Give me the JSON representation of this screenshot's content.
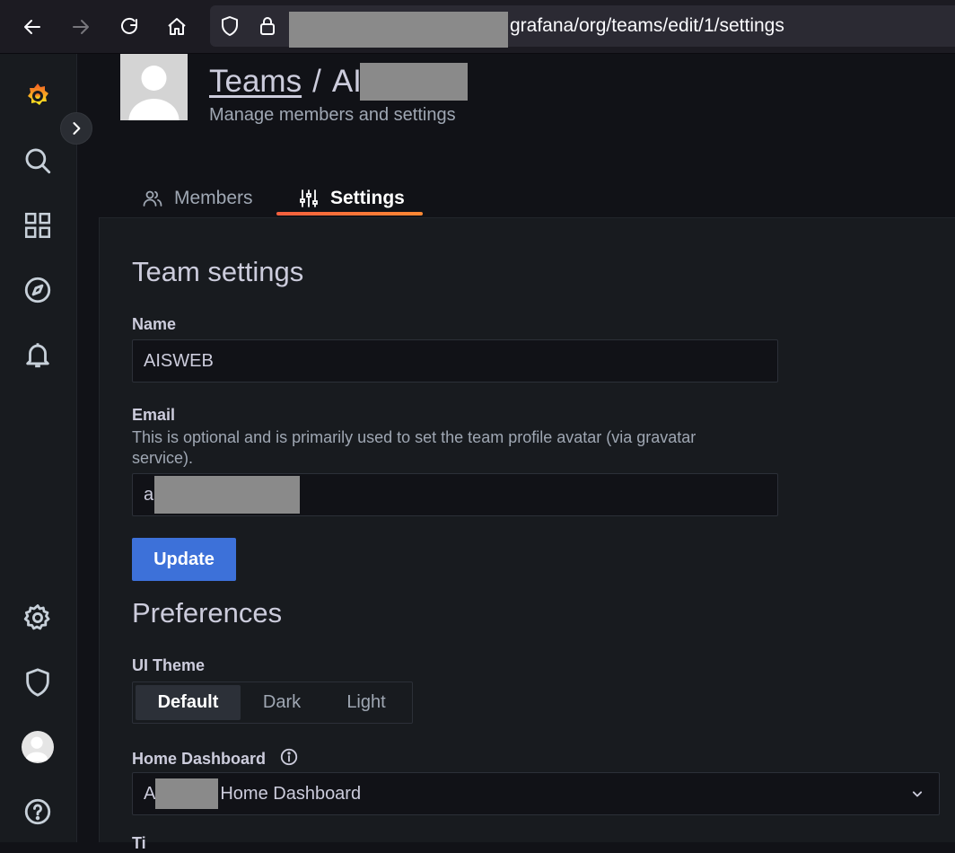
{
  "browser": {
    "url_text": "grafana/org/teams/edit/1/settings",
    "icons": [
      "back-arrow-icon",
      "forward-arrow-icon",
      "reload-icon",
      "home-icon",
      "shield-icon",
      "lock-icon"
    ]
  },
  "sidebar": {
    "items": [
      {
        "name": "grafana-logo-icon"
      },
      {
        "name": "search-icon"
      },
      {
        "name": "dashboards-grid-icon"
      },
      {
        "name": "explore-compass-icon"
      },
      {
        "name": "alerting-bell-icon"
      },
      {
        "name": "configuration-gear-icon"
      },
      {
        "name": "server-admin-shield-icon"
      },
      {
        "name": "user-avatar"
      },
      {
        "name": "help-question-icon"
      }
    ],
    "expand_icon": "chevron-right-icon"
  },
  "header": {
    "breadcrumb_parent": "Teams",
    "breadcrumb_separator": "/",
    "breadcrumb_current": "AI",
    "subtitle": "Manage members and settings"
  },
  "tabs": [
    {
      "label": "Members",
      "icon": "users-icon",
      "active": false
    },
    {
      "label": "Settings",
      "icon": "sliders-icon",
      "active": true
    }
  ],
  "team_settings": {
    "title": "Team settings",
    "name_label": "Name",
    "name_value": "AISWEB",
    "email_label": "Email",
    "email_description": "This is optional and is primarily used to set the team profile avatar (via gravatar service).",
    "email_value_prefix": "a",
    "update_label": "Update"
  },
  "preferences": {
    "title": "Preferences",
    "ui_theme_label": "UI Theme",
    "theme_options": [
      "Default",
      "Dark",
      "Light"
    ],
    "theme_selected": "Default",
    "home_dashboard_label": "Home Dashboard",
    "home_dashboard_prefix": "A",
    "home_dashboard_suffix": "Home Dashboard",
    "next_label_partial": "Ti"
  },
  "colors": {
    "accent_tab": "#ff8833",
    "primary_button": "#3d71d9",
    "panel_bg": "#181b1f",
    "page_bg": "#111217"
  }
}
